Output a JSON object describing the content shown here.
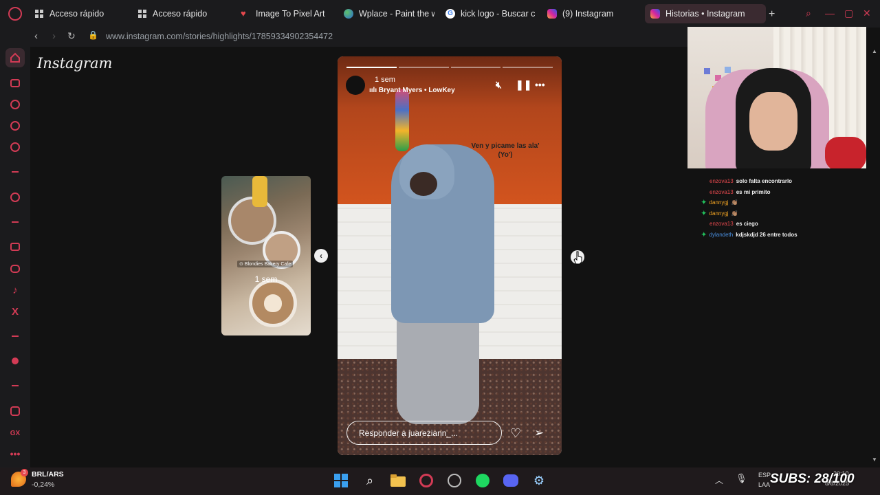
{
  "tabs": [
    {
      "label": "Acceso rápido",
      "icon": "grid-icon",
      "active": false
    },
    {
      "label": "Acceso rápido",
      "icon": "grid-icon",
      "active": false
    },
    {
      "label": "Image To Pixel Art",
      "icon": "heart-icon",
      "active": false
    },
    {
      "label": "Wplace - Paint the w",
      "icon": "globe-icon",
      "active": false
    },
    {
      "label": "kick logo - Buscar c",
      "icon": "google-icon",
      "active": false
    },
    {
      "label": "(9) Instagram",
      "icon": "instagram-icon",
      "active": false
    },
    {
      "label": "Historias • Instagram",
      "icon": "instagram-icon",
      "active": true
    }
  ],
  "address_bar": {
    "url": "www.instagram.com/stories/highlights/17859334902354472"
  },
  "instagram": {
    "logo": "Instagram",
    "prev_story": {
      "time": "1 sem",
      "location_tag": "⊙ Blondies Bakery Cafe"
    },
    "story": {
      "time": "1 sem",
      "music": "Bryant Myers • LowKey",
      "caption_line1": "Ven y picame las ala'",
      "caption_line2": "(Yo')",
      "progress": [
        1.0,
        0.0,
        0.0,
        0.0
      ],
      "reply_placeholder": "Responder a juareziann_..."
    }
  },
  "chat": [
    {
      "user": "enzova13",
      "message": "solo falta encontrarlo",
      "badge": false,
      "user_color": "#e5484d"
    },
    {
      "user": "enzova13",
      "message": "es mi primito",
      "badge": false,
      "user_color": "#e5484d"
    },
    {
      "user": "dannygj",
      "message": "👏🏽",
      "badge": true,
      "user_color": "#f5a623"
    },
    {
      "user": "dannygj",
      "message": "👏🏽",
      "badge": true,
      "user_color": "#f5a623"
    },
    {
      "user": "enzova13",
      "message": "es ciego",
      "badge": false,
      "user_color": "#e5484d"
    },
    {
      "user": "dylandeth",
      "message": "kdjskdjd 26 entre todos",
      "badge": true,
      "user_color": "#4a90e2"
    }
  ],
  "taskbar": {
    "ticker_symbol": "BRL/ARS",
    "ticker_change": "-0,24%",
    "ticker_badge": "3",
    "lang_top": "ESP",
    "lang_bottom": "LAA",
    "clock_time": "20:10",
    "clock_date": "8/8/2025",
    "subs_overlay": "SUBS: 28/100"
  },
  "colors": {
    "accent": "#d33b55",
    "background": "#121212",
    "chrome": "#1b1b1d"
  }
}
